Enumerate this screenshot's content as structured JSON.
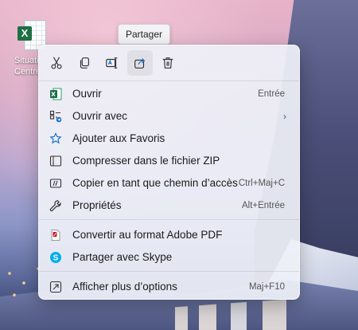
{
  "desktop": {
    "icon_label": "Situati… Centre…",
    "icon_lines": [
      "Situati",
      "Centre"
    ]
  },
  "tooltip": {
    "text": "Partager"
  },
  "toolbar": {
    "buttons": [
      {
        "name": "cut",
        "icon": "scissors-icon"
      },
      {
        "name": "copy",
        "icon": "copy-icon"
      },
      {
        "name": "rename",
        "icon": "rename-icon"
      },
      {
        "name": "share",
        "icon": "share-icon",
        "active": true
      },
      {
        "name": "delete",
        "icon": "trash-icon"
      }
    ]
  },
  "menu": {
    "items": [
      {
        "label": "Ouvrir",
        "shortcut": "Entrée",
        "icon": "excel-icon"
      },
      {
        "label": "Ouvrir avec",
        "shortcut": "",
        "icon": "open-with-icon",
        "submenu": true
      },
      {
        "label": "Ajouter aux Favoris",
        "shortcut": "",
        "icon": "star-icon"
      },
      {
        "label": "Compresser dans le fichier ZIP",
        "shortcut": "",
        "icon": "zip-icon"
      },
      {
        "label": "Copier en tant que chemin d’accès",
        "shortcut": "Ctrl+Maj+C",
        "icon": "path-icon"
      },
      {
        "label": "Propriétés",
        "shortcut": "Alt+Entrée",
        "icon": "wrench-icon"
      },
      {
        "label": "Convertir au format Adobe PDF",
        "shortcut": "",
        "icon": "pdf-icon"
      },
      {
        "label": "Partager avec Skype",
        "shortcut": "",
        "icon": "skype-icon"
      },
      {
        "label": "Afficher plus d’options",
        "shortcut": "Maj+F10",
        "icon": "more-options-icon"
      }
    ]
  },
  "colors": {
    "excel_green": "#1d7044",
    "accent_blue": "#1a73c9",
    "skype_blue": "#00aff0",
    "pdf_red": "#c8102e"
  }
}
